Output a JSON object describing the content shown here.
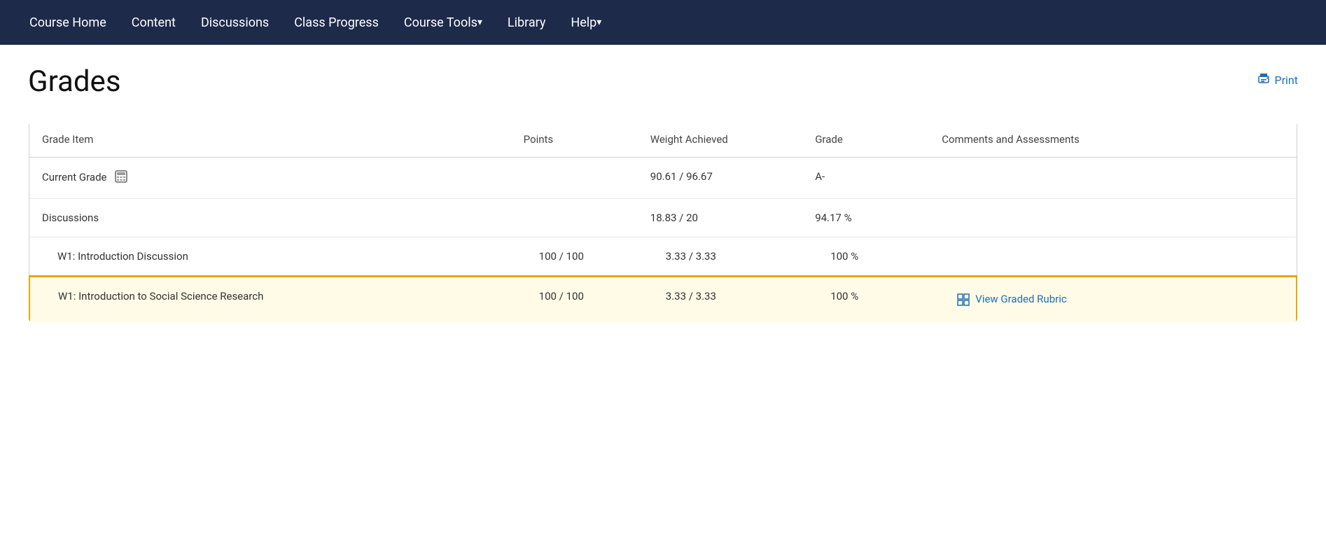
{
  "nav": {
    "items": [
      {
        "label": "Course Home",
        "id": "course-home",
        "hasArrow": false
      },
      {
        "label": "Content",
        "id": "content",
        "hasArrow": false
      },
      {
        "label": "Discussions",
        "id": "discussions",
        "hasArrow": false
      },
      {
        "label": "Class Progress",
        "id": "class-progress",
        "hasArrow": false
      },
      {
        "label": "Course Tools",
        "id": "course-tools",
        "hasArrow": true
      },
      {
        "label": "Library",
        "id": "library",
        "hasArrow": false
      },
      {
        "label": "Help",
        "id": "help",
        "hasArrow": true
      }
    ]
  },
  "page": {
    "title": "Grades",
    "print_label": "Print"
  },
  "table": {
    "headers": {
      "grade_item": "Grade Item",
      "points": "Points",
      "weight_achieved": "Weight Achieved",
      "grade": "Grade",
      "comments": "Comments and Assessments"
    },
    "rows": [
      {
        "id": "current-grade",
        "grade_item": "Current Grade",
        "has_calc_icon": true,
        "points": "",
        "weight_achieved": "90.61 / 96.67",
        "grade": "A-",
        "comments": "",
        "is_sub": false,
        "highlighted": false
      },
      {
        "id": "discussions",
        "grade_item": "Discussions",
        "has_calc_icon": false,
        "points": "",
        "weight_achieved": "18.83 / 20",
        "grade": "94.17 %",
        "comments": "",
        "is_sub": false,
        "highlighted": false
      },
      {
        "id": "w1-intro-discussion",
        "grade_item": "W1: Introduction Discussion",
        "has_calc_icon": false,
        "points": "100 / 100",
        "weight_achieved": "3.33 / 3.33",
        "grade": "100 %",
        "comments": "",
        "is_sub": true,
        "highlighted": false
      },
      {
        "id": "w1-intro-social",
        "grade_item": "W1: Introduction to Social Science Research",
        "has_calc_icon": false,
        "points": "100 / 100",
        "weight_achieved": "3.33 / 3.33",
        "grade": "100 %",
        "comments": "view_rubric",
        "comments_label": "View Graded Rubric",
        "is_sub": true,
        "highlighted": true
      }
    ]
  }
}
